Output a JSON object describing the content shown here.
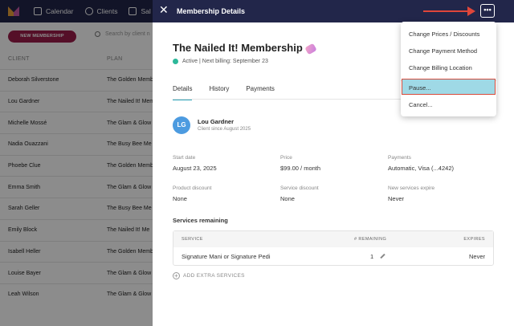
{
  "app": {
    "nav": [
      {
        "label": "Calendar",
        "icon": "calendar-icon"
      },
      {
        "label": "Clients",
        "icon": "clients-icon"
      },
      {
        "label": "Sal",
        "icon": "sales-icon"
      }
    ],
    "new_membership_label": "NEW MEMBERSHIP",
    "search_placeholder": "Search by client n",
    "columns": [
      "CLIENT",
      "PLAN"
    ],
    "rows": [
      {
        "client": "Deborah Silverstone",
        "plan": "The Golden Memb"
      },
      {
        "client": "Lou Gardner",
        "plan": "The Nailed It! Mem"
      },
      {
        "client": "Michelle Mossé",
        "plan": "The Glam & Glow"
      },
      {
        "client": "Nadia Ouazzani",
        "plan": "The Busy Bee Me"
      },
      {
        "client": "Phoebe Clue",
        "plan": "The Golden Memb"
      },
      {
        "client": "Emma Smith",
        "plan": "The Glam & Glow"
      },
      {
        "client": "Sarah Geller",
        "plan": "The Busy Bee Me"
      },
      {
        "client": "Emily Block",
        "plan": "The Nailed It! Me"
      },
      {
        "client": "Isabell Heller",
        "plan": "The Golden Memb"
      },
      {
        "client": "Louise Bayer",
        "plan": "The Glam & Glow"
      },
      {
        "client": "Leah Wilson",
        "plan": "The Glam & Glow"
      }
    ]
  },
  "panel": {
    "header_title": "Membership Details",
    "more_label": "•••",
    "membership_title": "The Nailed It! Membership",
    "status_text": "Active | Next billing: September 23",
    "tabs": [
      "Details",
      "History",
      "Payments"
    ],
    "client": {
      "initials": "LG",
      "name": "Lou Gardner",
      "since": "Client since August 2025"
    },
    "fields": {
      "start_date": {
        "label": "Start date",
        "value": "August 23, 2025"
      },
      "price": {
        "label": "Price",
        "value": "$99.00 / month"
      },
      "payments": {
        "label": "Payments",
        "value": "Automatic, Visa (...4242)"
      },
      "product_discount": {
        "label": "Product discount",
        "value": "None"
      },
      "service_discount": {
        "label": "Service discount",
        "value": "None"
      },
      "new_services_expire": {
        "label": "New services expire",
        "value": "Never"
      }
    },
    "services_remaining_title": "Services remaining",
    "services_table": {
      "headers": {
        "service": "SERVICE",
        "remaining": "# REMAINING",
        "expires": "EXPIRES"
      },
      "rows": [
        {
          "service": "Signature Mani or Signature Pedi",
          "remaining": "1",
          "expires": "Never"
        }
      ]
    },
    "add_services_label": "ADD EXTRA SERVICES"
  },
  "dropdown": {
    "items": [
      "Change Prices / Discounts",
      "Change Payment Method",
      "Change Billing Location",
      "Pause...",
      "Cancel..."
    ]
  },
  "colors": {
    "header": "#22264a",
    "brand_button": "#9b1d4a",
    "active_dot": "#2db89a",
    "tab_underline": "#2fa3b8",
    "highlight_fill": "#9fd9e6",
    "annotation_red": "#e0463a"
  }
}
